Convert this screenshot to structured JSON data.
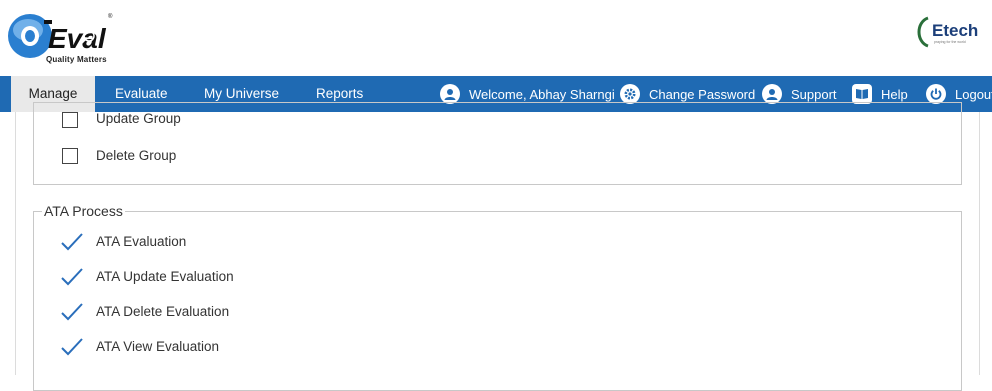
{
  "header": {
    "logo_text": "Q-Eval",
    "logo_tagline": "Quality Matters",
    "partner_logo": "Etech"
  },
  "nav": {
    "tabs": [
      {
        "label": "Manage",
        "active": true
      },
      {
        "label": "Evaluate"
      },
      {
        "label": "My Universe"
      },
      {
        "label": "Reports"
      }
    ],
    "welcome": "Welcome, Abhay Sharngi",
    "change_password": "Change Password",
    "support": "Support",
    "help": "Help",
    "logout": "Logout",
    "colors": {
      "bar": "#1f6ab3",
      "active_tab": "#e9e9e9"
    }
  },
  "group_section": {
    "items": [
      {
        "label": "Update Group",
        "checked": false
      },
      {
        "label": "Delete Group",
        "checked": false
      }
    ]
  },
  "ata_section": {
    "title": "ATA Process",
    "items": [
      {
        "label": "ATA Evaluation",
        "checked": true
      },
      {
        "label": "ATA Update Evaluation",
        "checked": true
      },
      {
        "label": "ATA Delete Evaluation",
        "checked": true
      },
      {
        "label": "ATA View Evaluation",
        "checked": true
      }
    ],
    "check_color": "#2a6ebb"
  }
}
